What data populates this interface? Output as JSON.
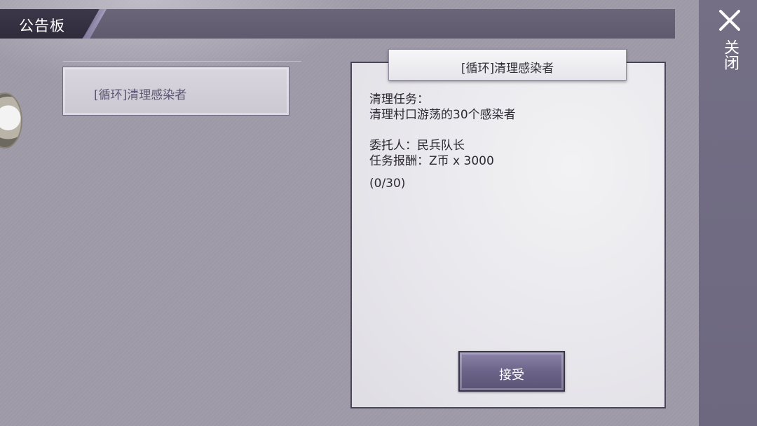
{
  "header": {
    "title": "公告板"
  },
  "quest_list": [
    {
      "label": "[循环]清理感染者"
    }
  ],
  "quest_detail": {
    "title": "[循环]清理感染者",
    "task_label": "清理任务：",
    "task_desc": "清理村口游荡的30个感染者",
    "client": "委托人：民兵队长",
    "reward": "任务报酬：Z币 x 3000",
    "progress": "(0/30)",
    "progress_current": 0,
    "progress_total": 30
  },
  "accept_button": {
    "label": "接受"
  },
  "close_button": {
    "label": "关闭",
    "icon": "close-icon"
  },
  "colors": {
    "accent": "#6c6488",
    "panel_paper": "#e8e7ec",
    "rail": "#746f85"
  }
}
